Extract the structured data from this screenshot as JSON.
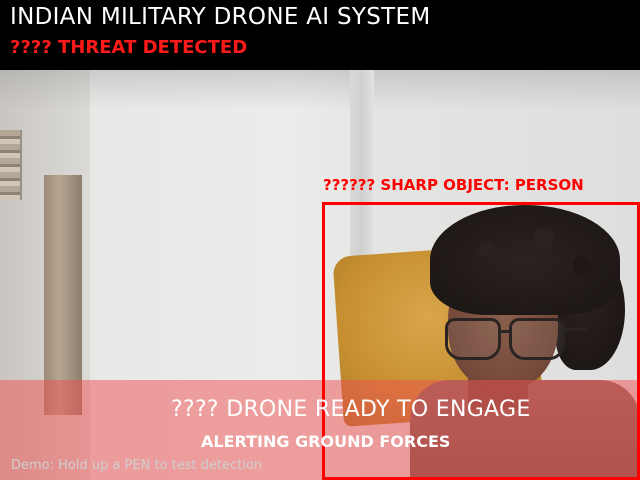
{
  "header": {
    "title": "INDIAN MILITARY DRONE AI SYSTEM",
    "threat_status": "???? THREAT DETECTED"
  },
  "detection": {
    "label": "?????? SHARP OBJECT: PERSON",
    "box_color": "#ff0000"
  },
  "alert": {
    "engage_text": "???? DRONE READY TO ENGAGE",
    "alerting_text": "ALERTING GROUND FORCES",
    "band_color": "#f05050"
  },
  "footer": {
    "demo_hint": "Demo: Hold up a PEN to test detection"
  },
  "colors": {
    "header_bg": "#000000",
    "title_text": "#ffffff",
    "threat_text": "#ff1a1a"
  }
}
